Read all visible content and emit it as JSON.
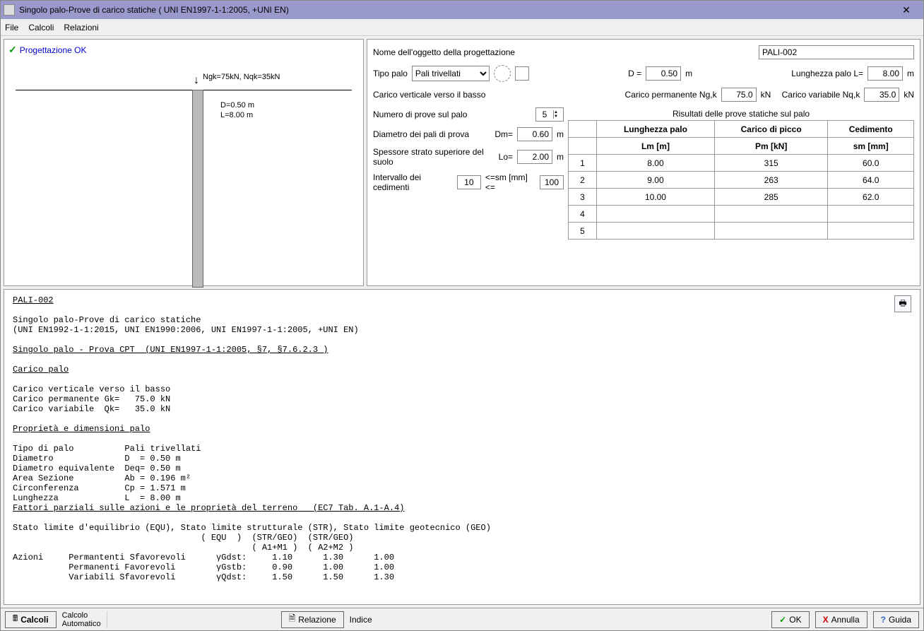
{
  "window": {
    "title": "Singolo palo-Prove di carico statiche ( UNI EN1997-1-1:2005, +UNI EN)",
    "close": "✕"
  },
  "menu": {
    "file": "File",
    "calcoli": "Calcoli",
    "relazioni": "Relazioni"
  },
  "status": {
    "text": "Progettazione OK"
  },
  "drawing": {
    "load_text": "Ngk=75kN, Nqk=35kN",
    "dim1": "D=0.50 m",
    "dim2": "L=8.00 m"
  },
  "form": {
    "name_label": "Nome dell'oggetto della progettazione",
    "name_value": "PALI-002",
    "tipo_label": "Tipo palo",
    "tipo_value": "Pali trivellati",
    "d_label": "D =",
    "d_value": "0.50",
    "d_unit": "m",
    "l_label": "Lunghezza palo L=",
    "l_value": "8.00",
    "l_unit": "m",
    "load_label": "Carico verticale verso il basso",
    "ngk_label": "Carico permanente Ng,k",
    "ngk_value": "75.0",
    "ngk_unit": "kN",
    "nqk_label": "Carico variabile Nq,k",
    "nqk_value": "35.0",
    "nqk_unit": "kN",
    "ntrials_label": "Numero di prove sul palo",
    "ntrials_value": "5",
    "dm_label": "Diametro dei pali di prova",
    "dm_prefix": "Dm=",
    "dm_value": "0.60",
    "dm_unit": "m",
    "lo_label": "Spessore strato superiore del suolo",
    "lo_prefix": "Lo=",
    "lo_value": "2.00",
    "lo_unit": "m",
    "sm_label": "Intervallo dei cedimenti",
    "sm_min": "10",
    "sm_mid": "<=sm [mm] <=",
    "sm_max": "100"
  },
  "table": {
    "caption": "Risultati delle prove statiche sul palo",
    "h1": "Lunghezza palo",
    "h2": "Carico di picco",
    "h3": "Cedimento",
    "u1": "Lm [m]",
    "u2": "Pm [kN]",
    "u3": "sm [mm]"
  },
  "chart_data": {
    "type": "table",
    "columns": [
      "Lunghezza palo Lm [m]",
      "Carico di picco Pm [kN]",
      "Cedimento sm [mm]"
    ],
    "rows": [
      {
        "n": 1,
        "Lm": 8.0,
        "Pm": 315,
        "sm": 60.0
      },
      {
        "n": 2,
        "Lm": 9.0,
        "Pm": 263,
        "sm": 64.0
      },
      {
        "n": 3,
        "Lm": 10.0,
        "Pm": 285,
        "sm": 62.0
      },
      {
        "n": 4,
        "Lm": null,
        "Pm": null,
        "sm": null
      },
      {
        "n": 5,
        "Lm": null,
        "Pm": null,
        "sm": null
      }
    ]
  },
  "report": {
    "title": "PALI-002",
    "line1": "Singolo palo-Prove di carico statiche",
    "line2": "(UNI EN1992-1-1:2015, UNI EN1990:2006, UNI EN1997-1-1:2005, +UNI EN)",
    "sec1": "Singolo palo - Prova CPT  (UNI EN1997-1-1:2005, §7, §7.6.2.3 )",
    "sec2": "Carico palo",
    "l_cv": "Carico verticale verso il basso",
    "l_gk": "Carico permanente Gk=   75.0 kN",
    "l_qk": "Carico variabile  Qk=   35.0 kN",
    "sec3": "Proprietà e dimensioni palo",
    "p_tipo": "Tipo di palo          Pali trivellati",
    "p_d": "Diametro              D  = 0.50 m",
    "p_deq": "Diametro equivalente  Deq= 0.50 m",
    "p_ab": "Area Sezione          Ab = 0.196 m²",
    "p_cp": "Circonferenza         Cp = 1.571 m",
    "p_l": "Lunghezza             L  = 8.00 m",
    "sec4": "Fattori parziali sulle azioni e le proprietà del terreno   (EC7 Tab. A.1-A.4)",
    "f_sl": "Stato limite d'equilibrio (EQU), Stato limite strutturale (STR), Stato limite geotecnico (GEO)",
    "f_hdr1": "                                     ( EQU  )  (STR/GEO)  (STR/GEO)",
    "f_hdr2": "                                               ( A1+M1 )  ( A2+M2 )",
    "f_a": "Azioni     Permantenti Sfavorevoli      γGdst:     1.10      1.30      1.00",
    "f_b": "           Permanenti Favorevoli        γGstb:     0.90      1.00      1.00",
    "f_c": "           Variabili Sfavorevoli        γQdst:     1.50      1.50      1.30"
  },
  "footer": {
    "calcoli_btn": "Calcoli",
    "calc_mode1": "Calcolo",
    "calc_mode2": "Automatico",
    "relazione_btn": "Relazione",
    "indice": "Indice",
    "ok": "OK",
    "annulla": "Annulla",
    "guida": "Guida"
  }
}
